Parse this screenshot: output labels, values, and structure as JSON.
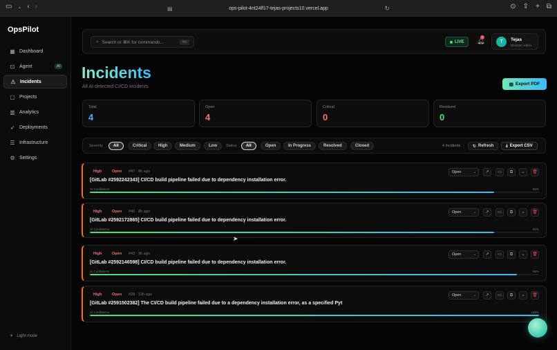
{
  "browser": {
    "url": "ops-pilot-4nt24lf17-tejas-projects10.vercel.app"
  },
  "sidebar": {
    "logo": "OpsPilot",
    "items": [
      {
        "label": "Dashboard",
        "icon": "grid-icon"
      },
      {
        "label": "Agent",
        "icon": "bot-icon",
        "badge": "AI"
      },
      {
        "label": "Incidents",
        "icon": "warning-icon",
        "active": true
      },
      {
        "label": "Projects",
        "icon": "folder-icon"
      },
      {
        "label": "Analytics",
        "icon": "chart-icon"
      },
      {
        "label": "Deployments",
        "icon": "rocket-icon"
      },
      {
        "label": "Infrastructure",
        "icon": "server-icon"
      },
      {
        "label": "Settings",
        "icon": "gear-icon"
      }
    ],
    "light_mode_label": "Light mode"
  },
  "header": {
    "search_placeholder": "Search or ⌘K for commands...",
    "search_shortcut": "⌘K",
    "live_label": "LIVE",
    "notification_count": "3",
    "user_initial": "T",
    "user_name": "Tejas",
    "user_role": "DevOps Admin"
  },
  "page": {
    "title": "Incidents",
    "subtitle": "All AI-detected CI/CD incidents",
    "export_pdf_label": "Export PDF"
  },
  "stats": [
    {
      "label": "Total",
      "value": "4",
      "color": "#60a5fa"
    },
    {
      "label": "Open",
      "value": "4",
      "color": "#f87171"
    },
    {
      "label": "Critical",
      "value": "0",
      "color": "#f87171"
    },
    {
      "label": "Resolved",
      "value": "0",
      "color": "#4ade80"
    }
  ],
  "filters": {
    "severity_label": "Severity",
    "severity_options": [
      "All",
      "Critical",
      "High",
      "Medium",
      "Low"
    ],
    "severity_selected": "All",
    "status_label": "Status",
    "status_options": [
      "All",
      "Open",
      "In Progress",
      "Resolved",
      "Closed"
    ],
    "status_selected": "All",
    "count_text": "4 incidents",
    "refresh_label": "Refresh",
    "export_csv_label": "Export CSV"
  },
  "incidents": [
    {
      "severity": "High",
      "status": "Open",
      "meta": "#47 · 8h ago",
      "title": "[GitLab #2592242343] CI/CD build pipeline failed due to dependency installation error.",
      "confidence_label": "AI Confidence",
      "confidence_text": "90%",
      "confidence": 0.9,
      "status_select": "Open"
    },
    {
      "severity": "High",
      "status": "Open",
      "meta": "#46 · 8h ago",
      "title": "[GitLab #2592172865] CI/CD build pipeline failed due to dependency installation error.",
      "confidence_label": "AI Confidence",
      "confidence_text": "90%",
      "confidence": 0.9,
      "status_select": "Open"
    },
    {
      "severity": "High",
      "status": "Open",
      "meta": "#43 · 9h ago",
      "title": "[GitLab #2592146598] CI/CD build pipeline failed due to dependency installation error.",
      "confidence_label": "AI Confidence",
      "confidence_text": "95%",
      "confidence": 0.95,
      "status_select": "Open"
    },
    {
      "severity": "High",
      "status": "Open",
      "meta": "#28 · 13h ago",
      "title": "[GitLab #2591502382] The CI/CD build pipeline failed due to a dependency installation error, as a specified Pyt",
      "confidence_label": "AI Confidence",
      "confidence_text": "100%",
      "confidence": 1.0,
      "status_select": "Open"
    }
  ]
}
